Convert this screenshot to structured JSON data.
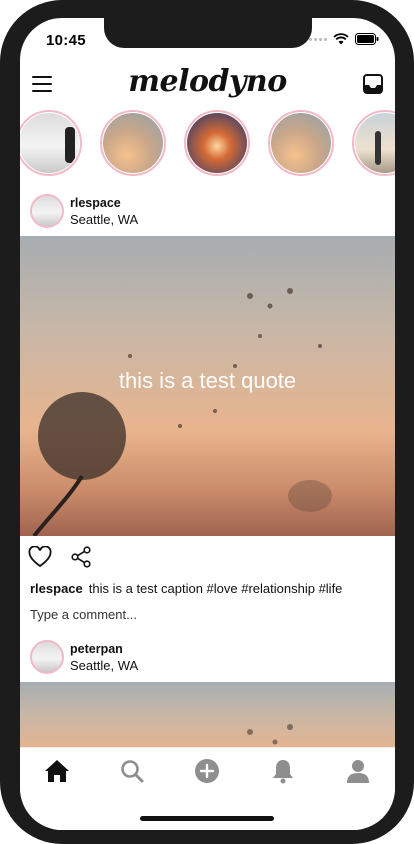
{
  "status": {
    "time": "10:45"
  },
  "app": {
    "title": "melodyno"
  },
  "stories": [
    {
      "name": "story-1"
    },
    {
      "name": "story-2"
    },
    {
      "name": "story-3"
    },
    {
      "name": "story-4"
    },
    {
      "name": "story-5"
    }
  ],
  "posts": [
    {
      "username": "rlespace",
      "location": "Seattle, WA",
      "quote": "this is a test quote",
      "caption_user": "rlespace",
      "caption": "this is a test caption #love #relationship #life",
      "comment_placeholder": "Type a comment..."
    },
    {
      "username": "peterpan",
      "location": "Seattle, WA"
    }
  ],
  "nav": {
    "items": [
      "home-icon",
      "search-icon",
      "add-icon",
      "bell-icon",
      "profile-icon"
    ]
  },
  "colors": {
    "story_ring": "#f2b9c7",
    "frame": "#1c1c1c",
    "icon_gray": "#8e8e8e"
  }
}
